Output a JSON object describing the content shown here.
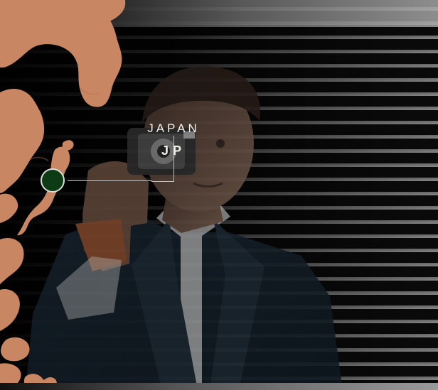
{
  "map": {
    "country_name": "JAPAN",
    "country_code": "JP"
  },
  "colors": {
    "land": "#C98662",
    "marker_fill": "#0D3B13",
    "marker_stroke": "#DCDCDC",
    "label_text": "#F0EFE9",
    "line": "#C8C8C8"
  },
  "icons": {
    "marker": "location-dot-icon"
  }
}
